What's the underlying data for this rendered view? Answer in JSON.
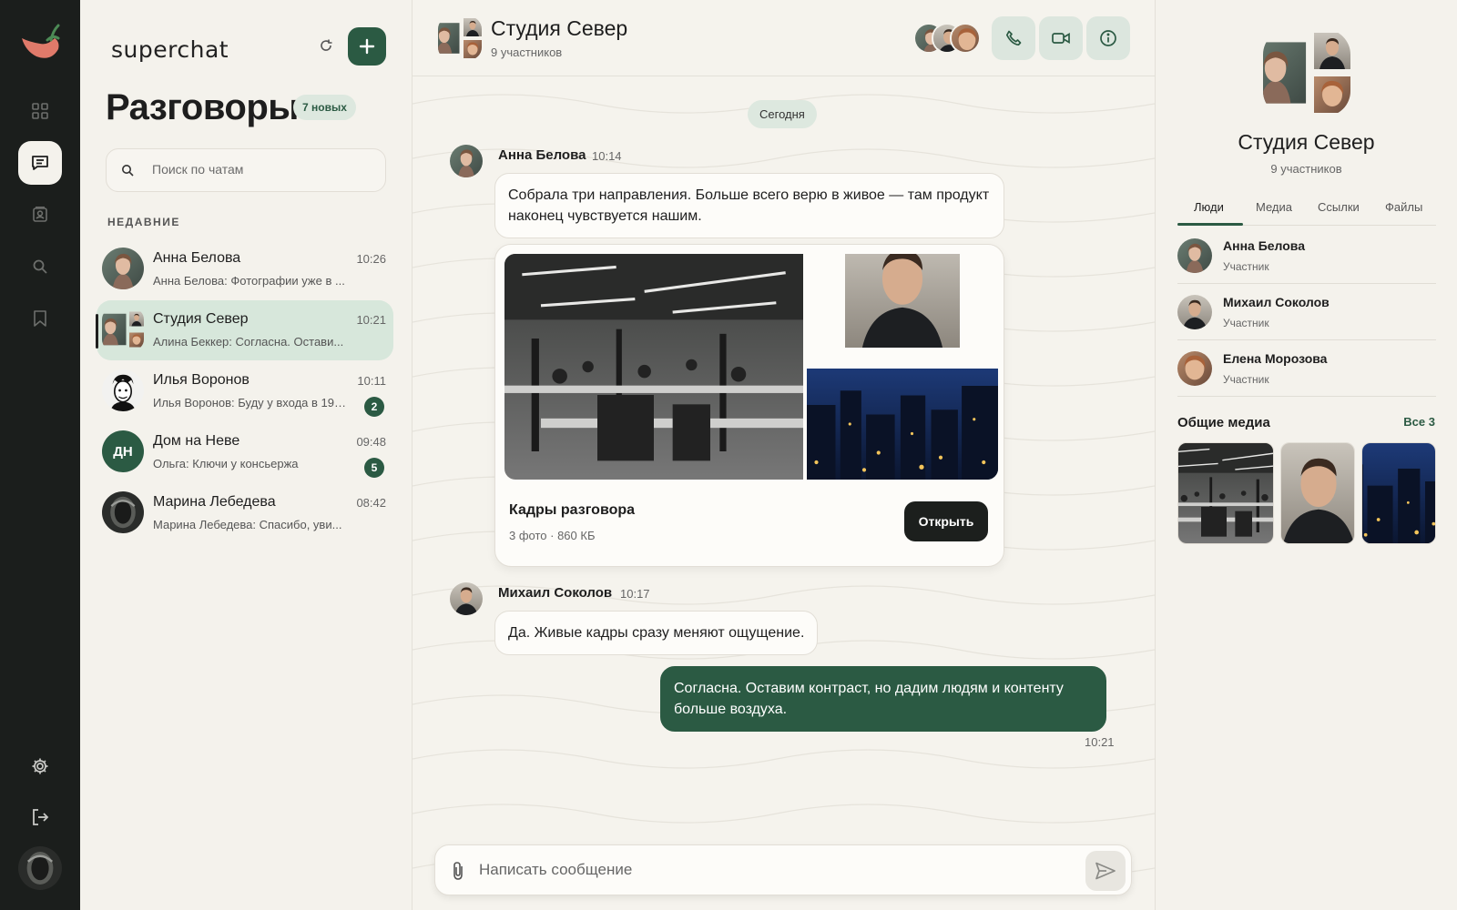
{
  "brand": {
    "name": "superchat"
  },
  "rail": {
    "icons": [
      "chili-logo-icon",
      "grid-icon",
      "chat-icon",
      "contacts-icon",
      "search-icon",
      "bookmark-icon",
      "settings-icon",
      "logout-icon"
    ],
    "active": "chat-icon"
  },
  "list": {
    "title": "Разговоры",
    "new_badge": "7 новых",
    "search_placeholder": "Поиск по чатам",
    "section_label": "НЕДАВНИЕ",
    "chats": [
      {
        "name": "Анна Белова",
        "time": "10:26",
        "preview": "Анна Белова: Фотографии уже в ...",
        "unread": ""
      },
      {
        "name": "Студия Север",
        "time": "10:21",
        "preview": "Алина Беккер: Согласна. Остави...",
        "unread": ""
      },
      {
        "name": "Илья Воронов",
        "time": "10:11",
        "preview": "Илья Воронов: Буду у входа в 19:...",
        "unread": "2"
      },
      {
        "name": "Дом на Неве",
        "time": "09:48",
        "preview": "Ольга: Ключи у консьержа",
        "unread": "5",
        "initials": "ДН"
      },
      {
        "name": "Марина Лебедева",
        "time": "08:42",
        "preview": "Марина Лебедева: Спасибо, уви...",
        "unread": ""
      }
    ]
  },
  "conversation": {
    "title": "Студия Север",
    "subtitle": "9 участников",
    "date_divider": "Сегодня",
    "messages": [
      {
        "sender": "Анна Белова",
        "time": "10:14",
        "text": "Собрала три направления. Больше всего верю в живое — там продукт наконец чувствуется нашим."
      },
      {
        "sender": "Михаил Соколов",
        "time": "10:17",
        "text": "Да. Живые кадры сразу меняют ощущение."
      },
      {
        "sender": "",
        "time": "10:21",
        "text": "Согласна. Оставим контраст, но дадим людям и контенту больше воздуха.",
        "mine": true
      }
    ],
    "media_card": {
      "title": "Кадры разговора",
      "meta": "3 фото · 860 КБ",
      "button": "Открыть"
    },
    "composer_placeholder": "Написать сообщение"
  },
  "info": {
    "title": "Студия Север",
    "subtitle": "9 участников",
    "tabs": [
      "Люди",
      "Медиа",
      "Ссылки",
      "Файлы"
    ],
    "active_tab": "Люди",
    "people": [
      {
        "name": "Анна Белова",
        "role": "Участник"
      },
      {
        "name": "Михаил Соколов",
        "role": "Участник"
      },
      {
        "name": "Елена Морозова",
        "role": "Участник"
      }
    ],
    "shared_media_title": "Общие медиа",
    "shared_media_all": "Все 3"
  },
  "colors": {
    "accent": "#2b5a43",
    "rail": "#1b1e1c",
    "background": "#f4f2ec",
    "selected": "#d7e7db"
  }
}
